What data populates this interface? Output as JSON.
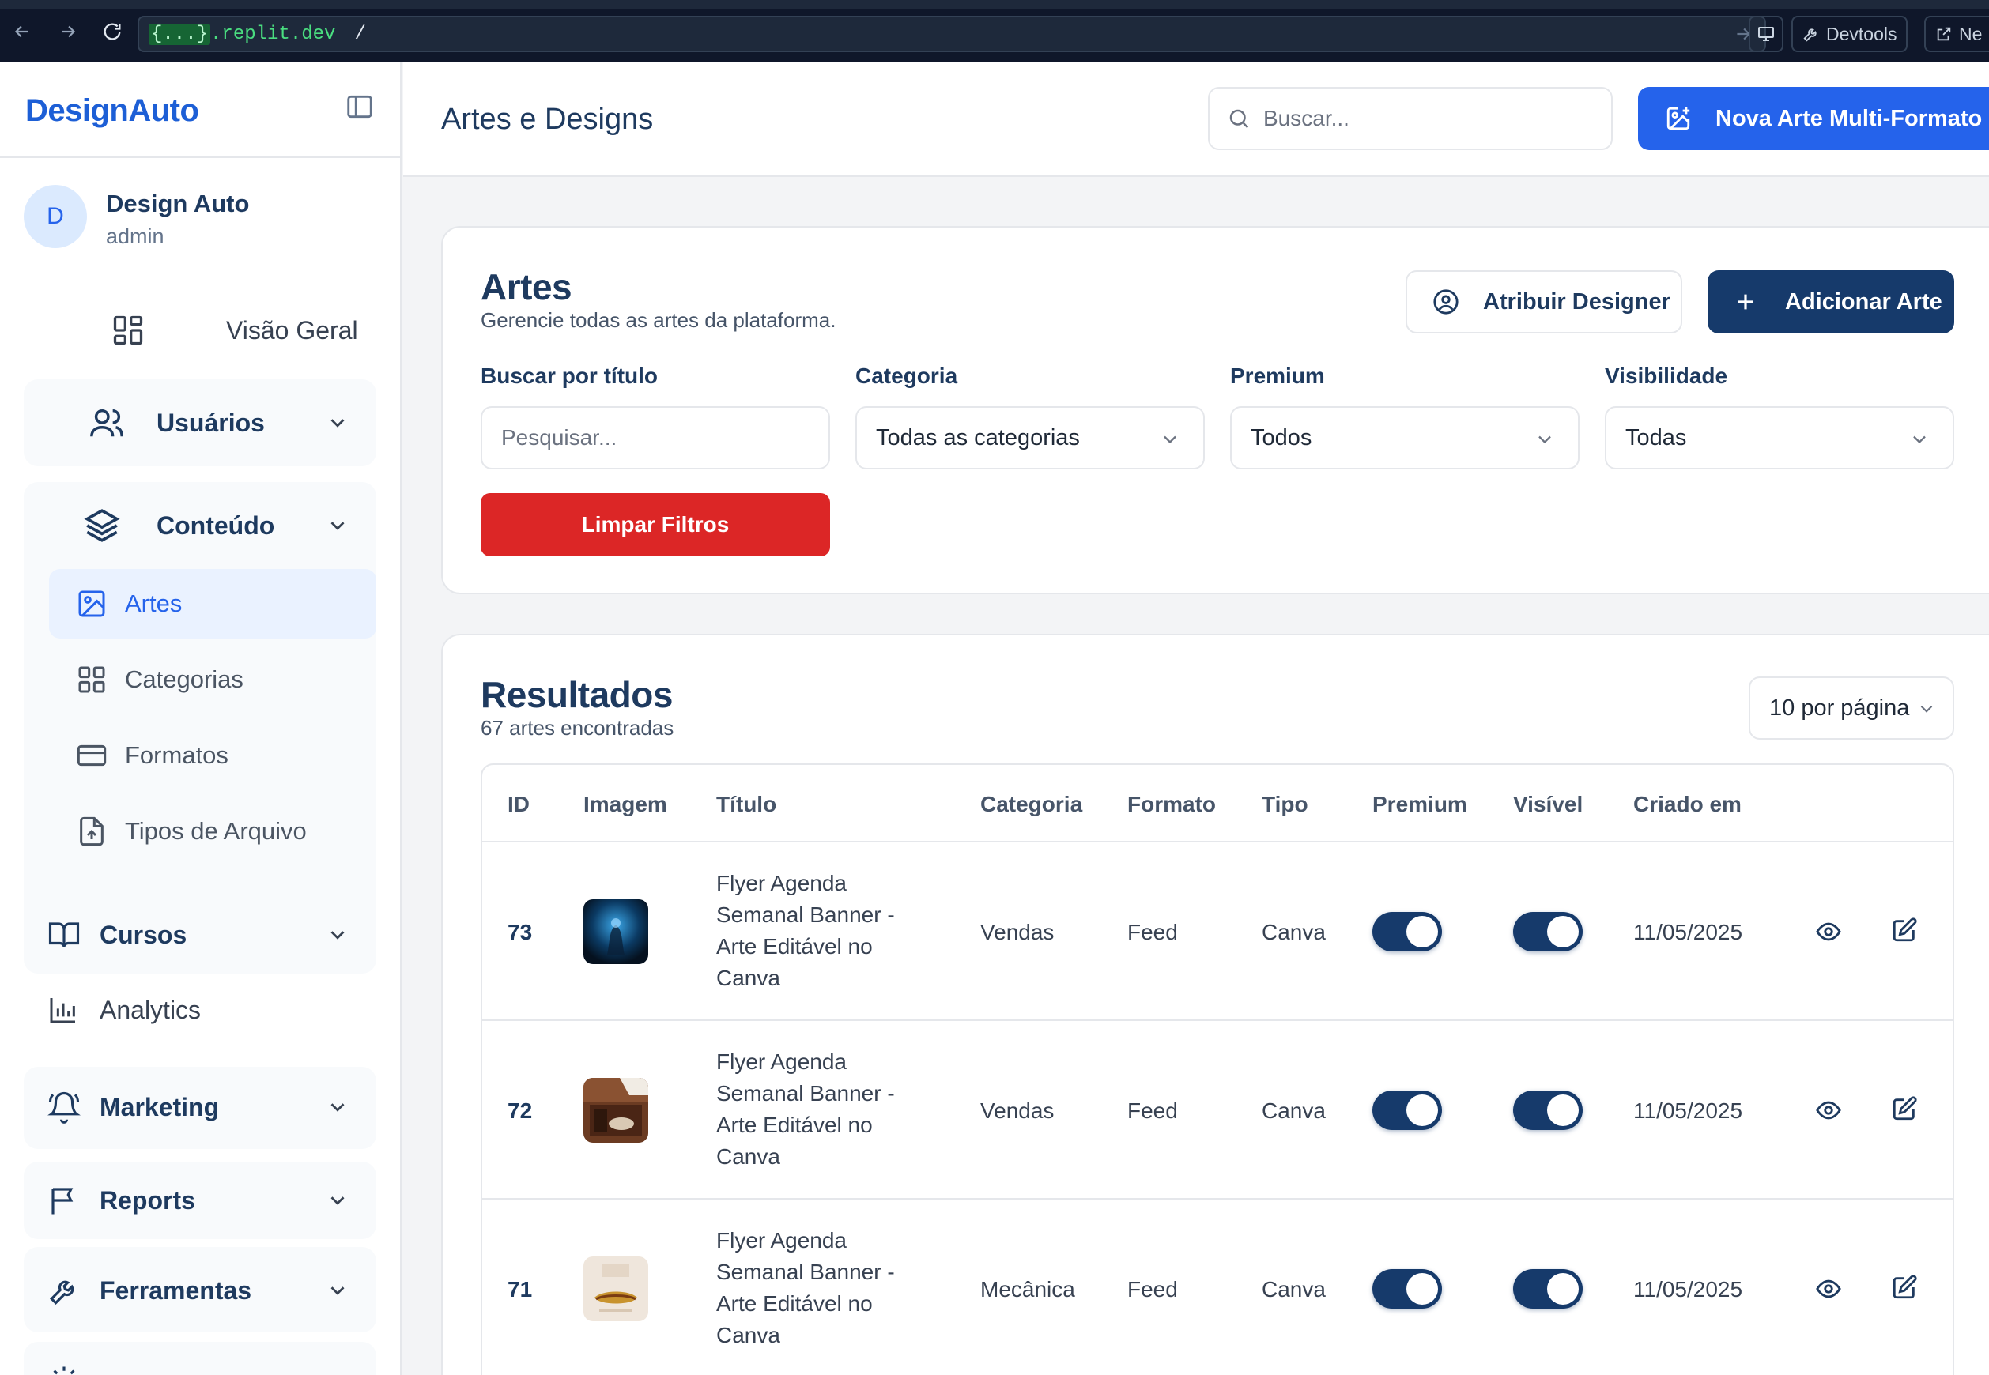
{
  "browser": {
    "url_host": ".replit.dev",
    "url_host_placeholder": "{...}",
    "url_path": "/",
    "devtools_label": "Devtools",
    "new_tab_label": "Ne"
  },
  "sidebar": {
    "brand": "DesignAuto",
    "user": {
      "initial": "D",
      "name": "Design Auto",
      "role": "admin"
    },
    "overview_label": "Visão Geral",
    "groups": {
      "usuarios": "Usuários",
      "conteudo": "Conteúdo",
      "cursos": "Cursos",
      "marketing": "Marketing",
      "reports": "Reports",
      "ferramentas": "Ferramentas"
    },
    "content_items": [
      {
        "label": "Artes",
        "icon": "image-icon",
        "active": true
      },
      {
        "label": "Categorias",
        "icon": "grid-icon",
        "active": false
      },
      {
        "label": "Formatos",
        "icon": "card-icon",
        "active": false
      },
      {
        "label": "Tipos de Arquivo",
        "icon": "file-upload-icon",
        "active": false
      }
    ],
    "analytics_label": "Analytics"
  },
  "topbar": {
    "title": "Artes e Designs",
    "search_placeholder": "Buscar...",
    "new_button": "Nova Arte Multi-Formato"
  },
  "filters_card": {
    "title": "Artes",
    "subtitle": "Gerencie todas as artes da plataforma.",
    "assign_button": "Atribuir Designer",
    "add_button": "Adicionar Arte",
    "labels": {
      "search": "Buscar por título",
      "category": "Categoria",
      "premium": "Premium",
      "visibility": "Visibilidade"
    },
    "search_placeholder": "Pesquisar...",
    "category_value": "Todas as categorias",
    "premium_value": "Todos",
    "visibility_value": "Todas",
    "clear_button": "Limpar Filtros"
  },
  "results_card": {
    "title": "Resultados",
    "count_text": "67 artes encontradas",
    "per_page": "10 por página",
    "columns": [
      "ID",
      "Imagem",
      "Título",
      "Categoria",
      "Formato",
      "Tipo",
      "Premium",
      "Visível",
      "Criado em"
    ],
    "rows": [
      {
        "id": "73",
        "title": "Flyer Agenda Semanal Banner - Arte Editável no Canva",
        "category": "Vendas",
        "format": "Feed",
        "type": "Canva",
        "premium": true,
        "visible": true,
        "created": "11/05/2025",
        "thumb": "dark-blue"
      },
      {
        "id": "72",
        "title": "Flyer Agenda Semanal Banner - Arte Editável no Canva",
        "category": "Vendas",
        "format": "Feed",
        "type": "Canva",
        "premium": true,
        "visible": true,
        "created": "11/05/2025",
        "thumb": "brown"
      },
      {
        "id": "71",
        "title": "Flyer Agenda Semanal Banner - Arte Editável no Canva",
        "category": "Mecânica",
        "format": "Feed",
        "type": "Canva",
        "premium": true,
        "visible": true,
        "created": "11/05/2025",
        "thumb": "light"
      }
    ]
  },
  "colors": {
    "brand_blue": "#1d5fd6",
    "primary_button": "#2563eb",
    "dark_navy": "#163a6b",
    "danger": "#dc2626",
    "active_bg": "#eaf2ff"
  }
}
